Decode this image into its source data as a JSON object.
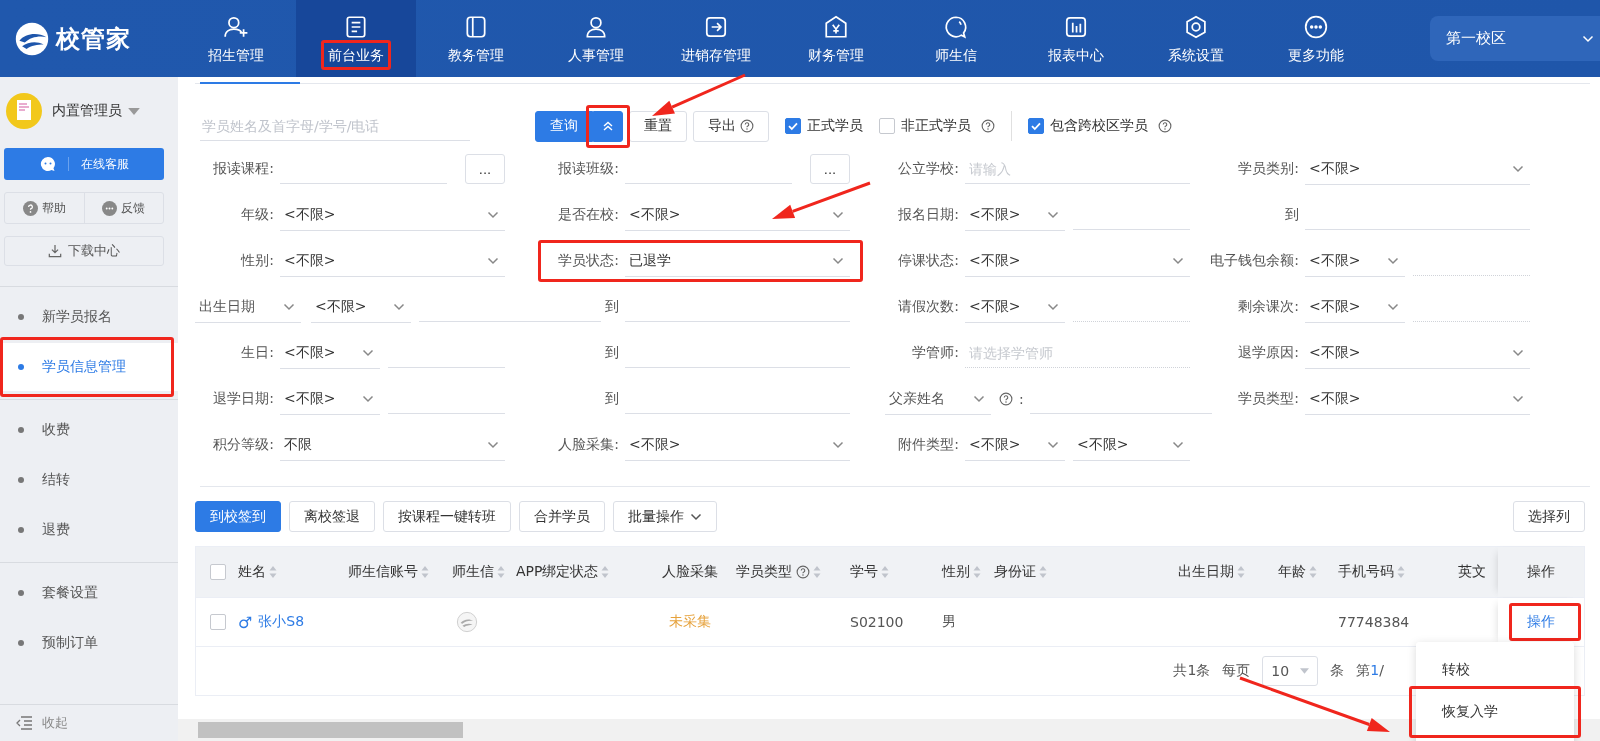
{
  "logo": {
    "text": "校管家"
  },
  "nav": {
    "items": [
      {
        "label": "招生管理",
        "selected": false,
        "highlighted": false
      },
      {
        "label": "前台业务",
        "selected": true,
        "highlighted": true
      },
      {
        "label": "教务管理",
        "selected": false,
        "highlighted": false
      },
      {
        "label": "人事管理",
        "selected": false,
        "highlighted": false
      },
      {
        "label": "进销存管理",
        "selected": false,
        "highlighted": false
      },
      {
        "label": "财务管理",
        "selected": false,
        "highlighted": false
      },
      {
        "label": "师生信",
        "selected": false,
        "highlighted": false
      },
      {
        "label": "报表中心",
        "selected": false,
        "highlighted": false
      },
      {
        "label": "系统设置",
        "selected": false,
        "highlighted": false
      },
      {
        "label": "更多功能",
        "selected": false,
        "highlighted": false
      }
    ],
    "campus": "第一校区"
  },
  "sidebar": {
    "user": "内置管理员",
    "service_button": "在线客服",
    "help_button": "帮助",
    "feedback_button": "反馈",
    "download_button": "下载中心",
    "groups": [
      [
        {
          "label": "新学员报名",
          "selected": false,
          "highlighted": false
        },
        {
          "label": "学员信息管理",
          "selected": true,
          "highlighted": true
        }
      ],
      [
        {
          "label": "收费",
          "selected": false,
          "highlighted": false
        },
        {
          "label": "结转",
          "selected": false,
          "highlighted": false
        },
        {
          "label": "退费",
          "selected": false,
          "highlighted": false
        }
      ],
      [
        {
          "label": "套餐设置",
          "selected": false,
          "highlighted": false
        },
        {
          "label": "预制订单",
          "selected": false,
          "highlighted": false
        }
      ]
    ],
    "collapse": "收起"
  },
  "search": {
    "placeholder": "学员姓名及首字母/学号/电话",
    "buttons": [
      {
        "label": "查询",
        "kind": "split",
        "highlighted": true
      },
      {
        "label": "重置",
        "kind": "plain"
      },
      {
        "label": "导出",
        "kind": "help"
      }
    ],
    "checks": [
      {
        "label": "正式学员",
        "checked": true,
        "kind": "plain"
      },
      {
        "label": "非正式学员",
        "checked": false,
        "kind": "help"
      }
    ],
    "extra_checks": [
      {
        "label": "包含跨校区学员",
        "checked": true,
        "kind": "help"
      }
    ]
  },
  "filters": [
    {
      "cells": [
        {
          "label": "报读课程:",
          "controls": [
            {
              "kind": "input"
            },
            {
              "kind": "browse",
              "text": "..."
            }
          ]
        },
        {
          "label": "报读班级:",
          "controls": [
            {
              "kind": "input"
            },
            {
              "kind": "browse",
              "text": "..."
            }
          ]
        },
        {
          "label": "公立学校:",
          "controls": [
            {
              "kind": "input",
              "placeholder": "请输入"
            }
          ]
        },
        {
          "label": "学员类别:",
          "controls": [
            {
              "kind": "select",
              "value": "<不限>"
            }
          ]
        }
      ]
    },
    {
      "cells": [
        {
          "label": "年级:",
          "controls": [
            {
              "kind": "select",
              "value": "<不限>"
            }
          ]
        },
        {
          "label": "是否在校:",
          "controls": [
            {
              "kind": "select",
              "value": "<不限>"
            }
          ]
        },
        {
          "label": "报名日期:",
          "controls": [
            {
              "kind": "select",
              "value": "<不限>"
            },
            {
              "kind": "input"
            }
          ]
        },
        {
          "label": "到",
          "controls": [
            {
              "kind": "input"
            }
          ]
        }
      ]
    },
    {
      "cells": [
        {
          "label": "性别:",
          "controls": [
            {
              "kind": "select",
              "value": "<不限>"
            }
          ]
        },
        {
          "label": "学员状态:",
          "highlighted": true,
          "controls": [
            {
              "kind": "select",
              "value": "已退学"
            }
          ]
        },
        {
          "label": "停课状态:",
          "controls": [
            {
              "kind": "select",
              "value": "<不限>"
            }
          ]
        },
        {
          "label": "电子钱包余额:",
          "controls": [
            {
              "kind": "select",
              "value": "<不限>"
            },
            {
              "kind": "input",
              "disabled": true
            }
          ]
        }
      ]
    },
    {
      "cells": [
        {
          "label_select": "出生日期",
          "controls": [
            {
              "kind": "select",
              "value": "<不限>"
            },
            {
              "kind": "input"
            }
          ]
        },
        {
          "label": "到",
          "controls": [
            {
              "kind": "input"
            }
          ]
        },
        {
          "label": "请假次数:",
          "controls": [
            {
              "kind": "select",
              "value": "<不限>"
            },
            {
              "kind": "input",
              "disabled": true
            }
          ]
        },
        {
          "label": "剩余课次:",
          "controls": [
            {
              "kind": "select",
              "value": "<不限>"
            },
            {
              "kind": "input",
              "disabled": true
            }
          ]
        }
      ]
    },
    {
      "cells": [
        {
          "label": "生日:",
          "controls": [
            {
              "kind": "select",
              "value": "<不限>"
            },
            {
              "kind": "input"
            }
          ]
        },
        {
          "label": "到",
          "controls": [
            {
              "kind": "input"
            }
          ]
        },
        {
          "label": "学管师:",
          "controls": [
            {
              "kind": "input",
              "placeholder": "请选择学管师",
              "disabled": true
            }
          ]
        },
        {
          "label": "退学原因:",
          "controls": [
            {
              "kind": "select",
              "value": "<不限>"
            }
          ]
        }
      ]
    },
    {
      "cells": [
        {
          "label": "退学日期:",
          "controls": [
            {
              "kind": "select",
              "value": "<不限>"
            },
            {
              "kind": "input"
            }
          ]
        },
        {
          "label": "到",
          "controls": [
            {
              "kind": "input"
            }
          ]
        },
        {
          "label_select": "父亲姓名",
          "help": true,
          "suffix": ":",
          "controls": [
            {
              "kind": "input"
            }
          ]
        },
        {
          "label": "学员类型:",
          "controls": [
            {
              "kind": "select",
              "value": "<不限>"
            }
          ]
        }
      ]
    },
    {
      "cells": [
        {
          "label": "积分等级:",
          "controls": [
            {
              "kind": "select",
              "value": "不限"
            }
          ]
        },
        {
          "label": "人脸采集:",
          "controls": [
            {
              "kind": "select",
              "value": "<不限>"
            }
          ]
        },
        {
          "label": "附件类型:",
          "controls": [
            {
              "kind": "select",
              "value": "<不限>"
            },
            {
              "kind": "select",
              "value": "<不限>"
            }
          ]
        }
      ]
    }
  ],
  "actions": [
    {
      "label": "到校签到",
      "kind": "primary"
    },
    {
      "label": "离校签退",
      "kind": "plain"
    },
    {
      "label": "按课程一键转班",
      "kind": "plain"
    },
    {
      "label": "合并学员",
      "kind": "plain"
    },
    {
      "label": "批量操作",
      "kind": "menu"
    }
  ],
  "column_button": "选择列",
  "table": {
    "all_checked": false,
    "columns": [
      {
        "label": "姓名",
        "kind": "sort"
      },
      {
        "label": "师生信账号",
        "kind": "sort"
      },
      {
        "label": "师生信",
        "kind": "sort"
      },
      {
        "label": "APP绑定状态",
        "kind": "sort"
      },
      {
        "label": "人脸采集",
        "kind": "plain"
      },
      {
        "label": "学员类型",
        "kind": "sort-help"
      },
      {
        "label": "学号",
        "kind": "sort"
      },
      {
        "label": "性别",
        "kind": "sort"
      },
      {
        "label": "身份证",
        "kind": "sort"
      },
      {
        "label": "出生日期",
        "kind": "sort"
      },
      {
        "label": "年龄",
        "kind": "sort"
      },
      {
        "label": "手机号码",
        "kind": "sort"
      },
      {
        "label": "英文",
        "kind": "plain"
      },
      {
        "label": "操作",
        "kind": "plain"
      }
    ],
    "rows": [
      {
        "checked": false,
        "cells": [
          {
            "kind": "name",
            "gender": "♂",
            "text": "张小S8"
          },
          {
            "kind": "blank"
          },
          {
            "kind": "logo"
          },
          {
            "kind": "blank"
          },
          {
            "kind": "warning",
            "text": "未采集"
          },
          {
            "kind": "blank"
          },
          {
            "kind": "text",
            "text": "S02100"
          },
          {
            "kind": "text",
            "text": "男"
          },
          {
            "kind": "blank"
          },
          {
            "kind": "blank"
          },
          {
            "kind": "blank"
          },
          {
            "kind": "text",
            "text": "77748384"
          },
          {
            "kind": "blank"
          },
          {
            "kind": "action",
            "text": "操作",
            "highlighted": true
          }
        ]
      }
    ]
  },
  "pagination": {
    "total": "共1条",
    "per_page_label": "每页",
    "per_page": "10",
    "unit": "条",
    "page": "第",
    "current": "1",
    "sep": "/"
  },
  "menu": {
    "items": [
      {
        "label": "转校",
        "highlighted": false
      },
      {
        "label": "恢复入学",
        "highlighted": true
      }
    ]
  }
}
